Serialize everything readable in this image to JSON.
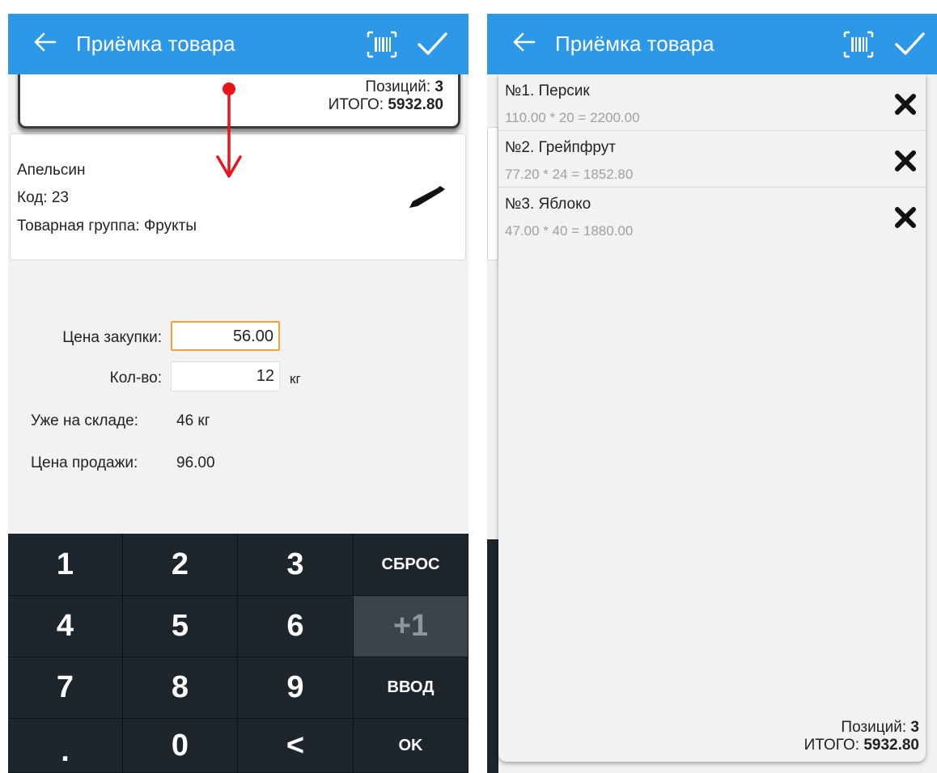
{
  "left_screen": {
    "appbar": {
      "title": "Приёмка товара"
    },
    "summary": {
      "positions_label": "Позиций:",
      "positions_value": "3",
      "total_label": "ИТОГО:",
      "total_value": "5932.80"
    },
    "product": {
      "name": "Апельсин",
      "code": "Код: 23",
      "group": "Товарная группа: Фрукты"
    },
    "form": {
      "purchase_price_label": "Цена закупки:",
      "purchase_price_value": "56.00",
      "qty_label": "Кол-во:",
      "qty_value": "12",
      "qty_unit": "кг",
      "in_stock_label": "Уже на складе:",
      "in_stock_value": "46 кг",
      "sale_price_label": "Цена продажи:",
      "sale_price_value": "96.00"
    },
    "keypad": {
      "k1": "1",
      "k2": "2",
      "k3": "3",
      "reset": "СБРОС",
      "k4": "4",
      "k5": "5",
      "k6": "6",
      "plus_one": "+1",
      "k7": "7",
      "k8": "8",
      "k9": "9",
      "enter": "ВВОД",
      "dot": ".",
      "k0": "0",
      "backspace": "<",
      "ok": "OK"
    }
  },
  "right_screen": {
    "appbar": {
      "title": "Приёмка товара"
    },
    "items": [
      {
        "name": "№1. Персик",
        "calc": "110.00 * 20 = 2200.00"
      },
      {
        "name": "№2. Грейпфрут",
        "calc": "77.20 * 24 = 1852.80"
      },
      {
        "name": "№3. Яблоко",
        "calc": "47.00 * 40 = 1880.00"
      }
    ],
    "summary": {
      "positions_label": "Позиций:",
      "positions_value": "3",
      "total_label": "ИТОГО:",
      "total_value": "5932.80"
    }
  },
  "icons": [
    "back-arrow-icon",
    "barcode-icon",
    "check-icon",
    "pencil-icon",
    "delete-x-icon",
    "swipe-down-arrow-icon"
  ],
  "colors": {
    "appbar": "#2d97e8",
    "keypad": "#1d262d",
    "active_field_border": "#f0a23d",
    "arrow": "#e8141c"
  }
}
